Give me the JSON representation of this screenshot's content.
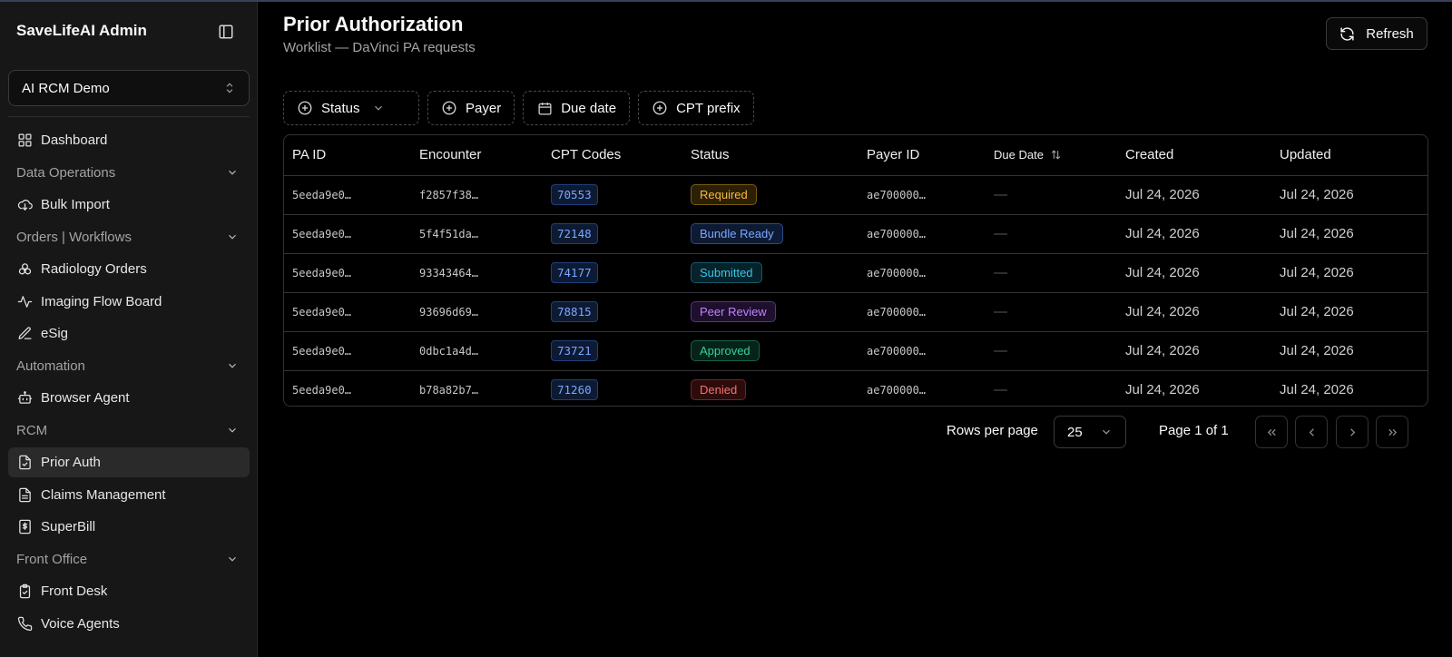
{
  "app": {
    "brand": "SaveLifeAI Admin",
    "org_selected": "AI RCM Demo"
  },
  "sidebar": {
    "items": [
      {
        "type": "item",
        "label": "Dashboard",
        "icon": "dashboard-grid-icon"
      },
      {
        "type": "group",
        "label": "Data Operations"
      },
      {
        "type": "item",
        "label": "Bulk Import",
        "icon": "cloud-download-icon"
      },
      {
        "type": "group",
        "label": "Orders | Workflows"
      },
      {
        "type": "item",
        "label": "Radiology Orders",
        "icon": "biohazard-icon"
      },
      {
        "type": "item",
        "label": "Imaging Flow Board",
        "icon": "activity-icon"
      },
      {
        "type": "item",
        "label": "eSig",
        "icon": "signature-icon"
      },
      {
        "type": "group",
        "label": "Automation"
      },
      {
        "type": "item",
        "label": "Browser Agent",
        "icon": "bot-icon"
      },
      {
        "type": "group",
        "label": "RCM"
      },
      {
        "type": "item",
        "label": "Prior Auth",
        "icon": "file-check-icon",
        "active": true
      },
      {
        "type": "item",
        "label": "Claims Management",
        "icon": "file-text-icon"
      },
      {
        "type": "item",
        "label": "SuperBill",
        "icon": "dollar-receipt-icon"
      },
      {
        "type": "group",
        "label": "Front Office"
      },
      {
        "type": "item",
        "label": "Front Desk",
        "icon": "clipboard-check-icon"
      },
      {
        "type": "item",
        "label": "Voice Agents",
        "icon": "phone-icon"
      }
    ]
  },
  "header": {
    "title": "Prior Authorization",
    "subtitle": "Worklist — DaVinci PA requests",
    "refresh_label": "Refresh"
  },
  "filters": {
    "status": "Status",
    "payer": "Payer",
    "due_date": "Due date",
    "cpt_prefix": "CPT prefix"
  },
  "table": {
    "columns": [
      "PA ID",
      "Encounter",
      "CPT Codes",
      "Status",
      "Payer ID",
      "Due Date",
      "Created",
      "Updated"
    ],
    "rows": [
      {
        "pa_id": "5eeda9e0…",
        "encounter": "f2857f38…",
        "cpt": "70553",
        "status": "Required",
        "payer": "ae700000…",
        "due": "—",
        "created": "Jul 24, 2026",
        "updated": "Jul 24, 2026"
      },
      {
        "pa_id": "5eeda9e0…",
        "encounter": "5f4f51da…",
        "cpt": "72148",
        "status": "Bundle Ready",
        "payer": "ae700000…",
        "due": "—",
        "created": "Jul 24, 2026",
        "updated": "Jul 24, 2026"
      },
      {
        "pa_id": "5eeda9e0…",
        "encounter": "93343464…",
        "cpt": "74177",
        "status": "Submitted",
        "payer": "ae700000…",
        "due": "—",
        "created": "Jul 24, 2026",
        "updated": "Jul 24, 2026"
      },
      {
        "pa_id": "5eeda9e0…",
        "encounter": "93696d69…",
        "cpt": "78815",
        "status": "Peer Review",
        "payer": "ae700000…",
        "due": "—",
        "created": "Jul 24, 2026",
        "updated": "Jul 24, 2026"
      },
      {
        "pa_id": "5eeda9e0…",
        "encounter": "0dbc1a4d…",
        "cpt": "73721",
        "status": "Approved",
        "payer": "ae700000…",
        "due": "—",
        "created": "Jul 24, 2026",
        "updated": "Jul 24, 2026"
      },
      {
        "pa_id": "5eeda9e0…",
        "encounter": "b78a82b7…",
        "cpt": "71260",
        "status": "Denied",
        "payer": "ae700000…",
        "due": "—",
        "created": "Jul 24, 2026",
        "updated": "Jul 24, 2026"
      }
    ]
  },
  "status_colors": {
    "Required": {
      "fg": "#f5b942",
      "bg": "#2b1f05",
      "border": "#7a5a10"
    },
    "Bundle Ready": {
      "fg": "#7aa7ff",
      "bg": "#0d1a33",
      "border": "#2a4a8a"
    },
    "Submitted": {
      "fg": "#38c6e8",
      "bg": "#06222b",
      "border": "#16586a"
    },
    "Peer Review": {
      "fg": "#c084fc",
      "bg": "#1e0f2e",
      "border": "#5b3287"
    },
    "Approved": {
      "fg": "#34d399",
      "bg": "#06231a",
      "border": "#16604a"
    },
    "Denied": {
      "fg": "#f87171",
      "bg": "#2d0b0b",
      "border": "#7a2222"
    }
  },
  "pagination": {
    "rows_per_page_label": "Rows per page",
    "rows_per_page_value": "25",
    "page_info": "Page 1 of 1"
  }
}
